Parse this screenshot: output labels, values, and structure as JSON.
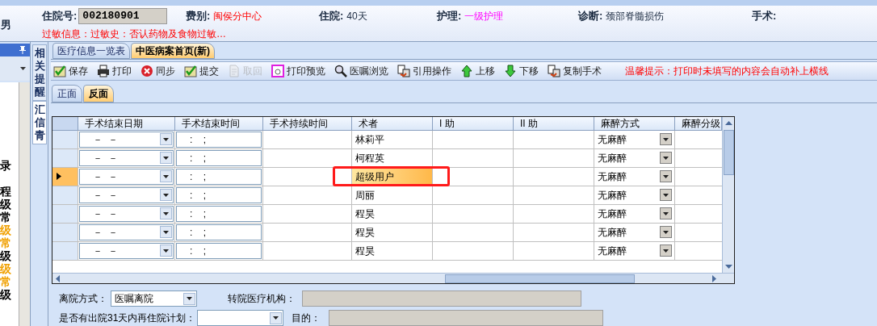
{
  "patient": {
    "sex": "男",
    "fields": [
      {
        "label": "住院号:",
        "value": "002180901",
        "kind": "box"
      },
      {
        "label": "费别:",
        "value": "闽侯分中心",
        "kind": "red"
      },
      {
        "label": "住院:",
        "value": "40天",
        "kind": "plain"
      },
      {
        "label": "护理:",
        "value": "一级护理",
        "kind": "magenta"
      },
      {
        "label": "诊断:",
        "value": "颈部脊髓损伤",
        "kind": "plain"
      },
      {
        "label": "手术:",
        "kind": "plain"
      }
    ],
    "allergy": "过敏信息：过敏史：否认药物及食物过敏…"
  },
  "sidebar": {
    "items": [
      {
        "text": "录",
        "color": "#000000"
      },
      {
        "text": "程",
        "color": "#000000"
      },
      {
        "text": "级",
        "color": "#000000"
      },
      {
        "text": "常",
        "color": "#000000"
      },
      {
        "text": "级",
        "color": "#f0a000"
      },
      {
        "text": "常",
        "color": "#f0a000"
      },
      {
        "text": "级",
        "color": "#000000"
      },
      {
        "text": "级",
        "color": "#f0a000"
      },
      {
        "text": "常",
        "color": "#f0a000"
      },
      {
        "text": "级",
        "color": "#000000"
      }
    ]
  },
  "side_tabs": [
    {
      "label": "相关提醒",
      "selected": false
    },
    {
      "label": "汇信青",
      "selected": true
    }
  ],
  "tabs": [
    {
      "label": "医疗信息一览表",
      "selected": false
    },
    {
      "label": "中医病案首页(新)",
      "selected": true
    }
  ],
  "toolbar": {
    "buttons": [
      {
        "label": "保存",
        "kind": "check",
        "disabled": false
      },
      {
        "label": "打印",
        "kind": "print",
        "disabled": false
      },
      {
        "label": "同步",
        "kind": "cross",
        "disabled": false
      },
      {
        "label": "提交",
        "kind": "check",
        "disabled": false
      },
      {
        "label": "取回",
        "kind": "doc",
        "disabled": true
      },
      {
        "label": "打印预览",
        "kind": "preview",
        "disabled": false
      },
      {
        "label": "医嘱浏览",
        "kind": "search",
        "disabled": false
      },
      {
        "label": "引用操作",
        "kind": "copy",
        "disabled": false
      },
      {
        "label": "上移",
        "kind": "up",
        "disabled": false
      },
      {
        "label": "下移",
        "kind": "down",
        "disabled": false
      },
      {
        "label": "复制手术",
        "kind": "copy",
        "disabled": false
      }
    ],
    "tip": "温馨提示：打印时未填写的内容会自动补上横线"
  },
  "sub_tabs": [
    {
      "label": "正面",
      "selected": false
    },
    {
      "label": "反面",
      "selected": true
    }
  ],
  "table": {
    "columns": [
      "手术结束日期",
      "手术结束时间",
      "手术持续时间",
      "术者",
      "I 助",
      "II 助",
      "麻醉方式",
      "麻醉分级"
    ],
    "rows": [
      {
        "end_date": "－  －",
        "end_time": ":    ;",
        "surgeon": "林莉平",
        "anesthesia": "无麻醉",
        "selected": false,
        "outlined": false
      },
      {
        "end_date": "－  －",
        "end_time": ":    ;",
        "surgeon": "柯程英",
        "anesthesia": "无麻醉",
        "selected": false,
        "outlined": false
      },
      {
        "end_date": "－  －",
        "end_time": ":    ;",
        "surgeon": "超级用户",
        "anesthesia": "无麻醉",
        "selected": true,
        "outlined": true
      },
      {
        "end_date": "－  －",
        "end_time": ":    ;",
        "surgeon": "周丽",
        "anesthesia": "无麻醉",
        "selected": false,
        "outlined": false
      },
      {
        "end_date": "－  －",
        "end_time": ":    ;",
        "surgeon": "程昊",
        "anesthesia": "无麻醉",
        "selected": false,
        "outlined": false
      },
      {
        "end_date": "－  －",
        "end_time": ":    ;",
        "surgeon": "程昊",
        "anesthesia": "无麻醉",
        "selected": false,
        "outlined": false
      },
      {
        "end_date": "－  －",
        "end_time": ":    ;",
        "surgeon": "程昊",
        "anesthesia": "无麻醉",
        "selected": false,
        "outlined": false
      }
    ]
  },
  "form": {
    "discharge_label": "离院方式：",
    "discharge_value": "医嘱离院",
    "transfer_label": "转院医疗机构：",
    "readmit_label": "是否有出院31天内再住院计划：",
    "purpose_label": "目的："
  }
}
